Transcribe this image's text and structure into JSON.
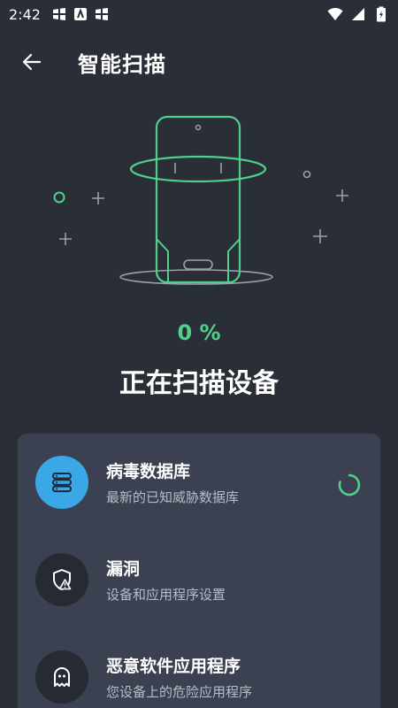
{
  "status_bar": {
    "time": "2:42",
    "icons_left": [
      "notification-icon",
      "app-icon",
      "notification-icon"
    ],
    "icons_right": [
      "wifi-icon",
      "signal-icon",
      "battery-charging-icon"
    ]
  },
  "header": {
    "title": "智能扫描",
    "back_icon": "arrow-left-icon"
  },
  "scan": {
    "progress": "0 %",
    "status": "正在扫描设备"
  },
  "colors": {
    "accent_green": "#4fd08c",
    "accent_blue": "#3aa7e6",
    "background": "#2a2e36",
    "card": "#3b4150"
  },
  "scan_items": [
    {
      "title": "病毒数据库",
      "subtitle": "最新的已知威胁数据库",
      "icon": "database-icon",
      "state": "scanning"
    },
    {
      "title": "漏洞",
      "subtitle": "设备和应用程序设置",
      "icon": "shield-warning-icon",
      "state": "pending"
    },
    {
      "title": "恶意软件应用程序",
      "subtitle": "您设备上的危险应用程序",
      "icon": "ghost-icon",
      "state": "pending"
    }
  ]
}
